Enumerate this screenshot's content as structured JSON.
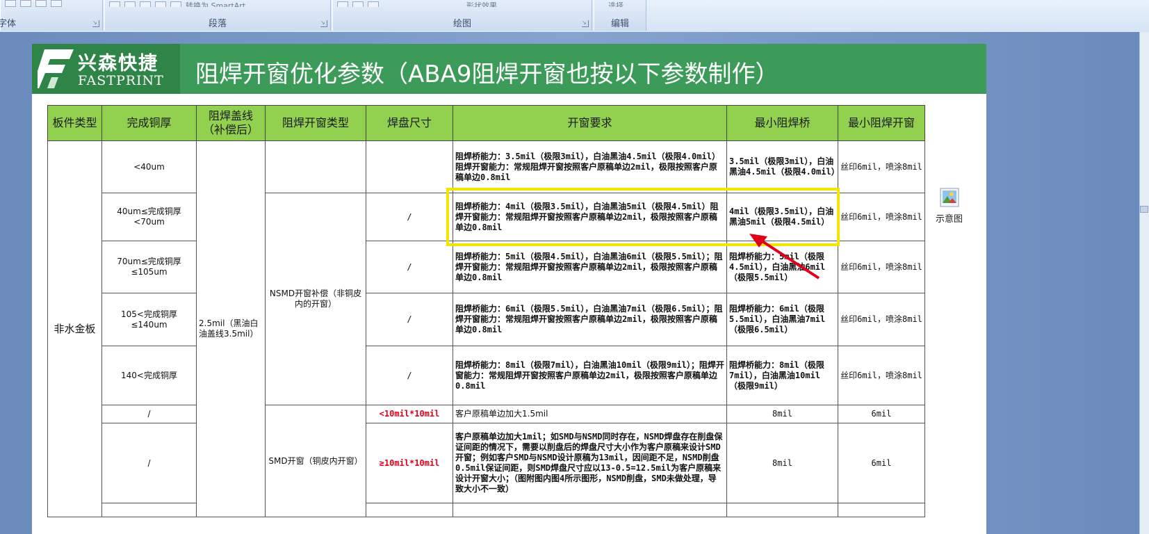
{
  "ribbon": {
    "groups": [
      {
        "label": "字体"
      },
      {
        "label": "段落",
        "faded_text": "转换为 SmartArt"
      },
      {
        "label": "绘图",
        "faded_text": "形状效果"
      },
      {
        "label": "编辑",
        "faded_text": "选择"
      }
    ]
  },
  "slide": {
    "logo_cn": "兴森快捷",
    "logo_en": "FASTPRINT",
    "title": "阻焊开窗优化参数（ABA9阻焊开窗也按以下参数制作）"
  },
  "table": {
    "headers": [
      "板件类型",
      "完成铜厚",
      "阻焊盖线（补偿后）",
      "阻焊开窗类型",
      "焊盘尺寸",
      "开窗要求",
      "最小阻焊桥",
      "最小阻焊开窗"
    ],
    "board_type": "非水金板",
    "cover_line": "2.5mil（黑油白油盖线3.5mil）",
    "nsmd_type": "NSMD开窗补偿（非铜皮内的开窗）",
    "smd_type": "SMD开窗（铜皮内开窗）",
    "rows": [
      {
        "thickness": "<40um",
        "pad": "",
        "req": "阻焊桥能力：3.5mil（极限3mil），白油黑油4.5mil（极限4.0mil）阻焊开窗能力：常规阻焊开窗按照客户原稿单边2mil，极限按照客户原稿单边0.8mil",
        "bridge": "3.5mil（极限3mil），白油黑油4.5mil（极限4.0mil）",
        "open": "丝印6mil，喷涂8mil"
      },
      {
        "thickness": "40um≤完成铜厚<70um",
        "pad": "/",
        "req": "阻焊桥能力：4mil（极限3.5mil），白油黑油5mil（极限4.5mil）阻焊开窗能力：常规阻焊开窗按照客户原稿单边2mil，极限按照客户原稿单边0.8mil",
        "bridge": "4mil（极限3.5mil），白油黑油5mil（极限4.5mil）",
        "open": "丝印6mil，喷涂8mil"
      },
      {
        "thickness": "70um≤完成铜厚≤105um",
        "pad": "/",
        "req": "阻焊桥能力：5mil（极限4.5mil），白油黑油6mil（极限5.5mil）；阻焊开窗能力：常规阻焊开窗按照客户原稿单边2mil，极限按照客户原稿单边0.8mil",
        "bridge": "阻焊桥能力：5mil（极限4.5mil），白油黑油6mil（极限5.5mil）",
        "open": "丝印6mil，喷涂8mil"
      },
      {
        "thickness": "105<完成铜厚≤140um",
        "pad": "/",
        "req": "阻焊桥能力：6mil（极限5.5mil），白油黑油7mil（极限6.5mil）；阻焊开窗能力：常规阻焊开窗按照客户原稿单边2mil，极限按照客户原稿单边0.8mil",
        "bridge": "阻焊桥能力：6mil（极限5.5mil），白油黑油7mil（极限6.5mil）",
        "open": "丝印6mil，喷涂8mil"
      },
      {
        "thickness": "140<完成铜厚",
        "pad": "/",
        "req": "阻焊桥能力：8mil（极限7mil），白油黑油10mil（极限9mil）；阻焊开窗能力：常规阻焊开窗按照客户原稿单边2mil，极限按照客户原稿单边0.8mil",
        "bridge": "阻焊桥能力：8mil（极限7mil），白油黑油10mil（极限9mil）",
        "open": "丝印6mil，喷涂8mil"
      },
      {
        "thickness": "/",
        "pad": "<10mil*10mil",
        "req": "客户原稿单边加大1.5mil",
        "bridge": "8mil",
        "open": "6mil"
      },
      {
        "thickness": "/",
        "pad": "≥10mil*10mil",
        "req": "客户原稿单边加大1mil；如SMD与NSMD同时存在，NSMD焊盘存在削盘保证间距的情况下，需要以削盘后的焊盘尺寸大小作为客户原稿来设计SMD开窗；例如客户SMD与NSMD设计原稿为13mil，因间距不足，NSMD削盘0.5mil保证间距，则SMD焊盘尺寸应以13-0.5=12.5mil为客户原稿来设计开窗大小；（图附图内图4所示图形，NSMD削盘，SMD未做处理，导致大小不一致）",
        "bridge": "8mil",
        "open": "6mil"
      }
    ]
  },
  "side_icon": {
    "label": "示意图",
    "icon": "image-icon"
  },
  "colors": {
    "header_green": "#3d9b5a",
    "table_header": "#92d050",
    "highlight": "#f2e600",
    "arrow": "#e0001a"
  }
}
